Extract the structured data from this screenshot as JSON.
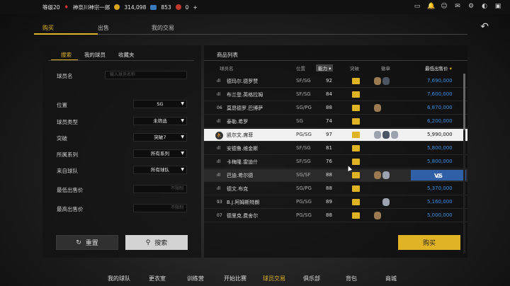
{
  "topbar": {
    "level": "等级20",
    "team": "神奈川神宗一郎",
    "coins": "314,098",
    "vc": "853",
    "badge": "0",
    "add": "+"
  },
  "main_tabs": [
    "购买",
    "出售",
    "我的交易"
  ],
  "left": {
    "tabs": [
      "搜索",
      "我的球员",
      "收藏夹"
    ],
    "name_label": "球员名",
    "name_placeholder": "输入球员名称",
    "filters": [
      {
        "label": "位置",
        "value": "SG"
      },
      {
        "label": "球员类型",
        "value": "未筛选"
      },
      {
        "label": "突破",
        "value": "突破7"
      },
      {
        "label": "所属系列",
        "value": "所有系列"
      },
      {
        "label": "来自球队",
        "value": "所有球队"
      }
    ],
    "min_price_label": "最低出售价",
    "max_price_label": "最高出售价",
    "price_placeholder": "不限制",
    "reset": "重置",
    "search": "搜索"
  },
  "right": {
    "title": "商品列表",
    "headers": {
      "name": "球员名",
      "position": "位置",
      "ability": "能力",
      "breakthrough": "突破",
      "badge": "徽章",
      "price": "最低出售价"
    },
    "rows": [
      {
        "sig": "ıll",
        "name": "德玛尔.德罗赞",
        "pos": "SF/SG",
        "ovr": "92",
        "price": "7,690,000"
      },
      {
        "sig": "ıll",
        "name": "布兰登.英格拉姆",
        "pos": "SF/SG",
        "ovr": "84",
        "price": "7,600,000"
      },
      {
        "sig": "06",
        "name": "莫昂德罗.巴博萨",
        "pos": "SG/PG",
        "ovr": "88",
        "price": "6,870,000"
      },
      {
        "sig": "ıll",
        "name": "泰勒.希罗",
        "pos": "SG",
        "ovr": "74",
        "price": "6,200,000"
      },
      {
        "sig": "",
        "name": "凯尔文.席菲",
        "pos": "PG/SG",
        "ovr": "97",
        "price": "5,990,000"
      },
      {
        "sig": "ıll",
        "name": "安德鲁.维金斯",
        "pos": "SF/SG",
        "ovr": "81",
        "price": "5,800,000"
      },
      {
        "sig": "ıll",
        "name": "卡梅隆.雷迪什",
        "pos": "SF/SG",
        "ovr": "76",
        "price": "5,800,000"
      },
      {
        "sig": "ıll",
        "name": "巴迪.希尔德",
        "pos": "SG/SF",
        "ovr": "88",
        "price": ""
      },
      {
        "sig": "ıll",
        "name": "德文.布克",
        "pos": "SG/PG",
        "ovr": "88",
        "price": "5,370,000"
      },
      {
        "sig": "93",
        "name": "B.J.阿姆斯特朗",
        "pos": "PG/SG",
        "ovr": "89",
        "price": "5,160,000"
      },
      {
        "sig": "07",
        "name": "德里克.费舍尔",
        "pos": "PG/SG",
        "ovr": "88",
        "price": "5,000,000"
      }
    ],
    "vs": "VS",
    "buy": "购买"
  },
  "bottom_nav": [
    "我的球队",
    "更衣室",
    "训练营",
    "开始比赛",
    "球员交易",
    "俱乐部",
    "背包",
    "商城"
  ]
}
